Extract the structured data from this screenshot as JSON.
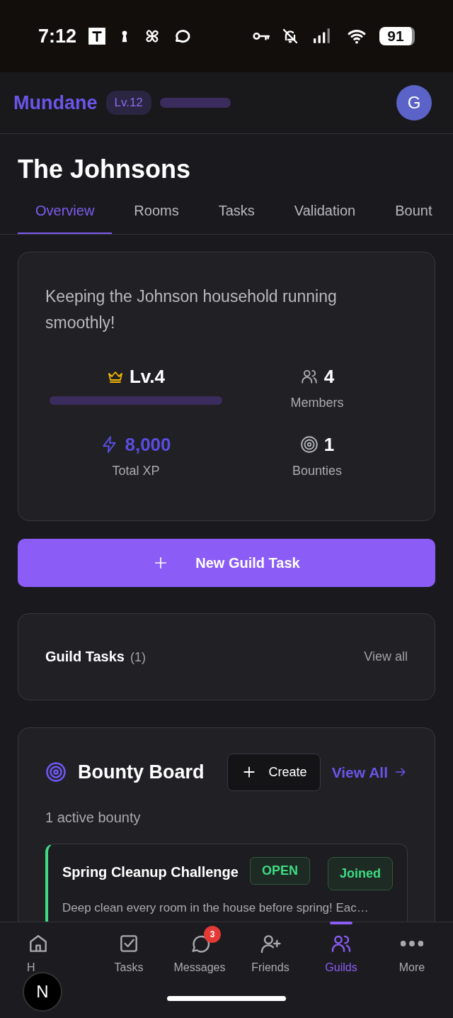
{
  "status_bar": {
    "time": "7:12",
    "battery": "91"
  },
  "header": {
    "app_name": "Mundane",
    "level_badge": "Lv.12",
    "avatar": "G"
  },
  "guild": {
    "name": "The Johnsons"
  },
  "tabs": [
    {
      "label": "Overview",
      "selected": true
    },
    {
      "label": "Rooms",
      "selected": false
    },
    {
      "label": "Tasks",
      "selected": false
    },
    {
      "label": "Validation",
      "selected": false
    },
    {
      "label": "Bount",
      "selected": false
    }
  ],
  "overview": {
    "description": "Keeping the Johnson household running smoothly!",
    "level": "Lv.4",
    "members_count": "4",
    "members_label": "Members",
    "xp_total": "8,000",
    "xp_label": "Total XP",
    "bounties_count": "1",
    "bounties_label": "Bounties"
  },
  "new_task_button": "New Guild Task",
  "guild_tasks": {
    "title": "Guild Tasks",
    "count": "(1)",
    "view_all": "View all"
  },
  "bounty_board": {
    "title": "Bounty Board",
    "create_button": "Create",
    "view_all": "View All",
    "summary": "1 active bounty",
    "bounties": [
      {
        "title": "Spring Cleanup Challenge",
        "status": "OPEN",
        "joined": "Joined",
        "description": "Deep clean every room in the house before spring! Eac…"
      }
    ]
  },
  "bottom_nav": [
    {
      "label": "H",
      "selected": false
    },
    {
      "label": "Tasks",
      "selected": false
    },
    {
      "label": "Messages",
      "selected": false,
      "badge": "3"
    },
    {
      "label": "Friends",
      "selected": false
    },
    {
      "label": "Guilds",
      "selected": true
    },
    {
      "label": "More",
      "selected": false
    }
  ],
  "floating_button": "N"
}
